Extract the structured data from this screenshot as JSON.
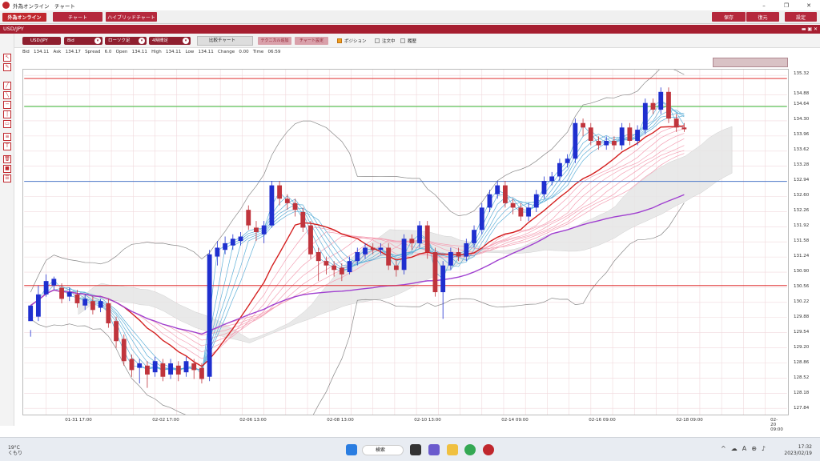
{
  "window": {
    "title": "外為オンライン　チャート",
    "min": "–",
    "max": "❐",
    "close": "✕"
  },
  "menubar": {
    "logo": "外為オンライン",
    "chart_tab": "チャート",
    "hybrid_tab": "ハイブリッドチャート",
    "save": "保存",
    "restore": "復元",
    "settings": "設定"
  },
  "subbar": {
    "pair": "USD/JPY",
    "controls": "▬ ▣ ✕"
  },
  "toolbar": {
    "pair_select": "USD/JPY",
    "price_select": "Bid",
    "type_select": "ローソク足",
    "period_select": "4時間足",
    "compare": "比較チャート",
    "tech_add": "テクニカル追加",
    "chart_settings": "チャート設定",
    "position": "ポジション",
    "orders": "注文中",
    "history": "履歴"
  },
  "quote": {
    "text": "Bid   134.11   Ask   134.17   Spread   6.0   Open   134.11   High   134.11   Low   134.11   Change   0.00   Time   06:59"
  },
  "chart_data": {
    "type": "candlestick",
    "symbol": "USD/JPY",
    "timeframe": "4時間足",
    "y_ticks": [
      "135.32",
      "134.88",
      "134.64",
      "134.30",
      "133.96",
      "133.62",
      "133.28",
      "132.94",
      "132.60",
      "132.26",
      "131.92",
      "131.58",
      "131.24",
      "130.90",
      "130.56",
      "130.22",
      "129.88",
      "129.54",
      "129.20",
      "128.86",
      "128.52",
      "128.18",
      "127.84"
    ],
    "ylim": [
      127.7,
      135.45
    ],
    "x_ticks": [
      "01-31 17:00",
      "02-02 17:00",
      "02-06 13:00",
      "02-08 13:00",
      "02-10 13:00",
      "02-14 09:00",
      "02-16 09:00",
      "02-18 09:00",
      "02-20 09:00"
    ],
    "candles": [
      [
        129.8,
        130.15,
        129.6,
        129.45
      ],
      [
        129.9,
        130.4,
        129.8,
        130.6
      ],
      [
        130.4,
        130.7,
        130.35,
        130.85
      ],
      [
        130.6,
        130.75,
        130.5,
        130.8
      ],
      [
        130.55,
        130.3,
        130.2,
        130.65
      ],
      [
        130.35,
        130.45,
        130.25,
        130.55
      ],
      [
        130.4,
        130.2,
        130.1,
        130.5
      ],
      [
        130.15,
        130.3,
        130.05,
        130.4
      ],
      [
        130.25,
        130.05,
        129.95,
        130.35
      ],
      [
        130.1,
        130.25,
        130.0,
        130.3
      ],
      [
        130.2,
        129.75,
        129.65,
        130.3
      ],
      [
        129.8,
        129.35,
        129.2,
        129.9
      ],
      [
        129.4,
        128.9,
        128.8,
        129.5
      ],
      [
        128.95,
        128.7,
        128.55,
        129.05
      ],
      [
        128.75,
        128.85,
        128.4,
        128.95
      ],
      [
        128.8,
        128.6,
        128.3,
        128.9
      ],
      [
        128.65,
        128.9,
        128.55,
        129.0
      ],
      [
        128.85,
        128.55,
        128.45,
        128.95
      ],
      [
        128.6,
        128.85,
        128.5,
        128.95
      ],
      [
        128.8,
        128.6,
        128.45,
        128.9
      ],
      [
        128.65,
        128.9,
        128.55,
        129.0
      ],
      [
        128.85,
        128.7,
        128.5,
        128.95
      ],
      [
        128.75,
        128.5,
        128.4,
        128.85
      ],
      [
        128.55,
        131.3,
        128.45,
        131.4
      ],
      [
        131.25,
        131.45,
        131.05,
        131.6
      ],
      [
        131.4,
        131.55,
        131.3,
        131.7
      ],
      [
        131.5,
        131.65,
        131.4,
        131.75
      ],
      [
        131.6,
        131.7,
        131.5,
        131.8
      ],
      [
        132.3,
        131.95,
        131.85,
        132.4
      ],
      [
        131.9,
        131.8,
        131.6,
        132.05
      ],
      [
        131.75,
        131.95,
        131.55,
        132.05
      ],
      [
        131.95,
        132.85,
        131.9,
        132.95
      ],
      [
        132.85,
        132.55,
        132.4,
        132.95
      ],
      [
        132.55,
        132.45,
        132.3,
        132.65
      ],
      [
        132.45,
        132.3,
        132.15,
        132.55
      ],
      [
        132.25,
        131.9,
        131.8,
        132.35
      ],
      [
        131.95,
        131.3,
        131.2,
        132.05
      ],
      [
        131.35,
        131.15,
        130.7,
        131.45
      ],
      [
        131.15,
        131.05,
        130.85,
        131.25
      ],
      [
        131.05,
        130.95,
        130.8,
        131.15
      ],
      [
        131.0,
        130.85,
        130.7,
        131.1
      ],
      [
        130.9,
        131.15,
        130.85,
        131.25
      ],
      [
        131.15,
        131.35,
        131.05,
        131.45
      ],
      [
        131.3,
        131.45,
        131.2,
        131.55
      ],
      [
        131.45,
        131.4,
        131.3,
        131.55
      ],
      [
        131.4,
        131.45,
        131.3,
        131.55
      ],
      [
        131.45,
        131.05,
        130.95,
        131.55
      ],
      [
        131.05,
        130.95,
        130.8,
        131.15
      ],
      [
        130.95,
        131.65,
        130.85,
        131.75
      ],
      [
        131.65,
        131.55,
        131.4,
        131.75
      ],
      [
        131.55,
        131.95,
        131.45,
        132.05
      ],
      [
        131.95,
        131.35,
        131.2,
        132.05
      ],
      [
        131.35,
        130.45,
        130.35,
        131.45
      ],
      [
        130.45,
        131.05,
        129.85,
        131.15
      ],
      [
        131.05,
        131.35,
        130.95,
        131.45
      ],
      [
        131.35,
        131.25,
        131.15,
        131.45
      ],
      [
        131.25,
        131.55,
        131.15,
        131.65
      ],
      [
        131.55,
        131.85,
        131.45,
        131.95
      ],
      [
        131.85,
        132.35,
        131.75,
        132.45
      ],
      [
        132.35,
        132.65,
        132.25,
        132.75
      ],
      [
        132.65,
        132.85,
        132.55,
        132.95
      ],
      [
        132.85,
        132.45,
        132.35,
        132.95
      ],
      [
        132.45,
        132.35,
        132.2,
        132.55
      ],
      [
        132.35,
        132.15,
        132.05,
        132.45
      ],
      [
        132.15,
        132.35,
        132.05,
        132.45
      ],
      [
        132.35,
        132.65,
        132.25,
        132.75
      ],
      [
        132.65,
        132.95,
        132.55,
        133.05
      ],
      [
        132.95,
        133.05,
        132.85,
        133.15
      ],
      [
        133.05,
        133.35,
        132.95,
        133.45
      ],
      [
        133.35,
        133.45,
        133.25,
        133.55
      ],
      [
        133.45,
        134.25,
        133.35,
        134.35
      ],
      [
        134.25,
        134.15,
        133.95,
        134.35
      ],
      [
        134.15,
        133.85,
        133.75,
        134.25
      ],
      [
        133.85,
        133.75,
        133.65,
        133.95
      ],
      [
        133.75,
        133.85,
        133.65,
        133.95
      ],
      [
        133.85,
        133.75,
        133.65,
        133.95
      ],
      [
        133.75,
        134.15,
        133.65,
        134.25
      ],
      [
        134.15,
        133.85,
        133.75,
        134.25
      ],
      [
        133.85,
        134.1,
        133.75,
        134.2
      ],
      [
        134.1,
        134.7,
        134.0,
        134.8
      ],
      [
        134.7,
        134.55,
        134.45,
        134.8
      ],
      [
        134.55,
        134.95,
        134.45,
        135.05
      ],
      [
        134.95,
        134.35,
        134.25,
        135.05
      ],
      [
        134.35,
        134.15,
        134.05,
        134.45
      ],
      [
        134.15,
        134.11,
        134.05,
        134.25
      ]
    ],
    "horizontal_lines": [
      {
        "price": 135.25,
        "color": "#e03030"
      },
      {
        "price": 134.62,
        "color": "#3cc03c"
      },
      {
        "price": 132.94,
        "color": "#4a78c8"
      },
      {
        "price": 130.6,
        "color": "#e03030"
      }
    ],
    "bull_color": "#1f2fcf",
    "bear_color": "#c0343c"
  },
  "taskbar": {
    "temp": "19°C",
    "weather": "くもり",
    "search": "検索",
    "time": "17:32",
    "date": "2023/02/19",
    "ime": "A"
  }
}
